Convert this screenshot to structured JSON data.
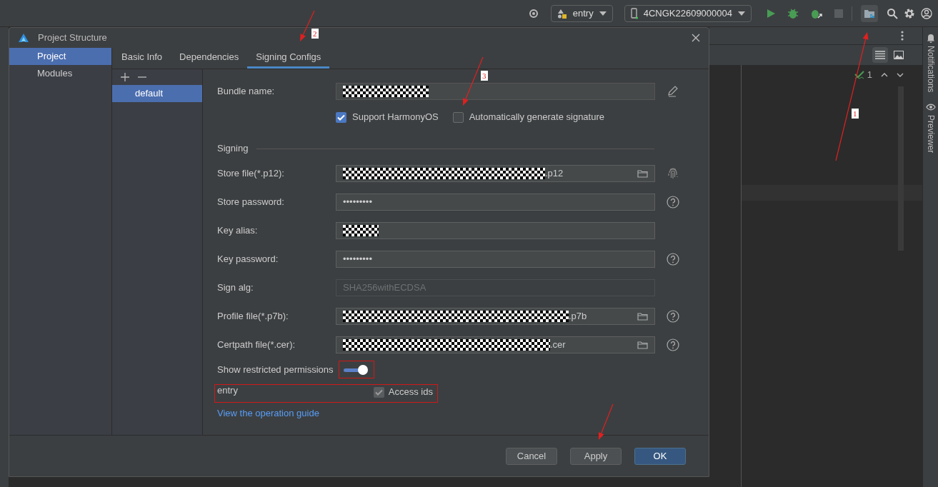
{
  "toolbar": {
    "run_config": "entry",
    "device": "4CNGK22609000004"
  },
  "side_panel": {
    "tools": [
      "Notifications",
      "Previewer"
    ]
  },
  "editor": {
    "problem_count": "1"
  },
  "dialog": {
    "title": "Project Structure",
    "nav": [
      {
        "label": "Project",
        "selected": true
      },
      {
        "label": "Modules",
        "selected": false
      }
    ],
    "tabs": [
      {
        "label": "Basic Info",
        "selected": false
      },
      {
        "label": "Dependencies",
        "selected": false
      },
      {
        "label": "Signing Configs",
        "selected": true
      }
    ],
    "configs": [
      {
        "label": "default",
        "selected": true
      }
    ],
    "bundle": {
      "label": "Bundle name:",
      "redacted": true
    },
    "options": [
      {
        "label": "Support HarmonyOS",
        "checked": true
      },
      {
        "label": "Automatically generate signature",
        "checked": false
      }
    ],
    "section": "Signing",
    "fields": [
      {
        "kind": "file",
        "label": "Store file(*.p12):",
        "redacted": true,
        "value": ".p12"
      },
      {
        "kind": "password",
        "label": "Store password:",
        "value": "•••••••••"
      },
      {
        "kind": "text",
        "label": "Key alias:",
        "redacted": true
      },
      {
        "kind": "password",
        "label": "Key password:",
        "value": "•••••••••"
      },
      {
        "kind": "readonly",
        "label": "Sign alg:",
        "value": "SHA256withECDSA"
      },
      {
        "kind": "file",
        "label": "Profile file(*.p7b):",
        "redacted": true,
        "value": ".p7b"
      },
      {
        "kind": "file",
        "label": "Certpath file(*.cer):",
        "redacted": true,
        "value": ".cer"
      }
    ],
    "restricted": {
      "label": "Show restricted permissions",
      "on": true
    },
    "permission": {
      "module": "entry",
      "label": "Access ids",
      "checked": true
    },
    "link": "View the operation guide",
    "buttons": [
      {
        "label": "Cancel",
        "kind": "normal"
      },
      {
        "label": "Apply",
        "kind": "normal"
      },
      {
        "label": "OK",
        "kind": "primary"
      }
    ]
  },
  "annotations": [
    {
      "label": "1"
    },
    {
      "label": "2"
    },
    {
      "label": "3"
    }
  ]
}
